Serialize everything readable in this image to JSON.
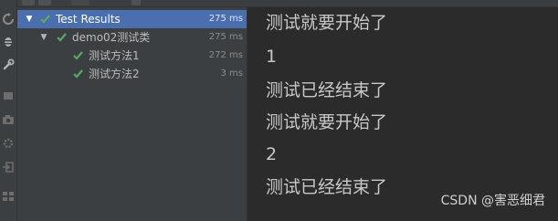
{
  "tree": {
    "items": [
      {
        "label": "Test Results",
        "time": "275 ms",
        "expanded": true,
        "selected": true,
        "status": "passed"
      },
      {
        "label": "demo02测试类",
        "time": "275 ms",
        "expanded": true,
        "selected": false,
        "status": "passed"
      },
      {
        "label": "测试方法1",
        "time": "272 ms",
        "expanded": false,
        "selected": false,
        "status": "passed"
      },
      {
        "label": "测试方法2",
        "time": "3 ms",
        "expanded": false,
        "selected": false,
        "status": "passed"
      }
    ]
  },
  "console": {
    "lines": [
      "测试就要开始了",
      "1",
      "测试已经结束了",
      "测试就要开始了",
      "2",
      "测试已经结束了"
    ]
  },
  "watermark": "CSDN @害恶细君",
  "colors": {
    "pass_green": "#59a869",
    "selection": "#4b6eaf",
    "panel_bg": "#3c3f41",
    "console_bg": "#2b2b2b"
  },
  "icons": {
    "tree_arrow": "chevron-down-icon",
    "status": "check-icon"
  }
}
